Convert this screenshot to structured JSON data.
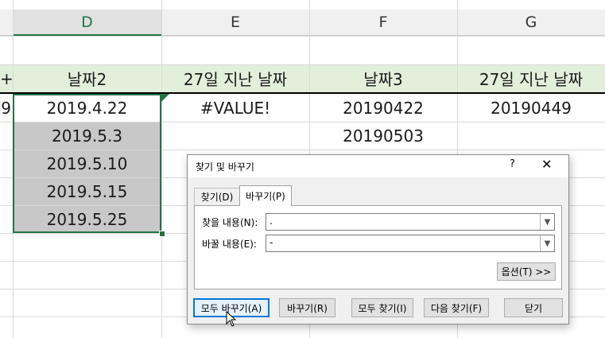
{
  "columns": {
    "d": "D",
    "e": "E",
    "f": "F",
    "g": "G"
  },
  "header_row": {
    "d": "날짜2",
    "e": "27일 지난 날짜",
    "f": "날짜3",
    "g": "27일 지난 날짜"
  },
  "partial_left": {
    "header": "+",
    "value": "9"
  },
  "col_d": [
    "2019.4.22",
    "2019.5.3",
    "2019.5.10",
    "2019.5.15",
    "2019.5.25"
  ],
  "col_e": [
    "#VALUE!"
  ],
  "col_f": [
    "20190422",
    "20190503"
  ],
  "col_g": [
    "20190449"
  ],
  "dialog": {
    "title": "찾기 및 바꾸기",
    "help": "?",
    "close": "✕",
    "tabs": {
      "find": "찾기(D)",
      "replace": "바꾸기(P)"
    },
    "find_label": "찾을 내용(N):",
    "find_value": ".",
    "replace_label": "바꿀 내용(E):",
    "replace_value": "-",
    "options_button": "옵션(T) >>",
    "buttons": {
      "replace_all": "모두 바꾸기(A)",
      "replace": "바꾸기(R)",
      "find_all": "모두 찾기(I)",
      "find_next": "다음 찾기(F)",
      "close": "닫기"
    }
  },
  "colors": {
    "header_fill": "#e2efda",
    "selected_fill": "#c8c8c8",
    "selection_border": "#217346",
    "default_button_border": "#0078d7"
  }
}
